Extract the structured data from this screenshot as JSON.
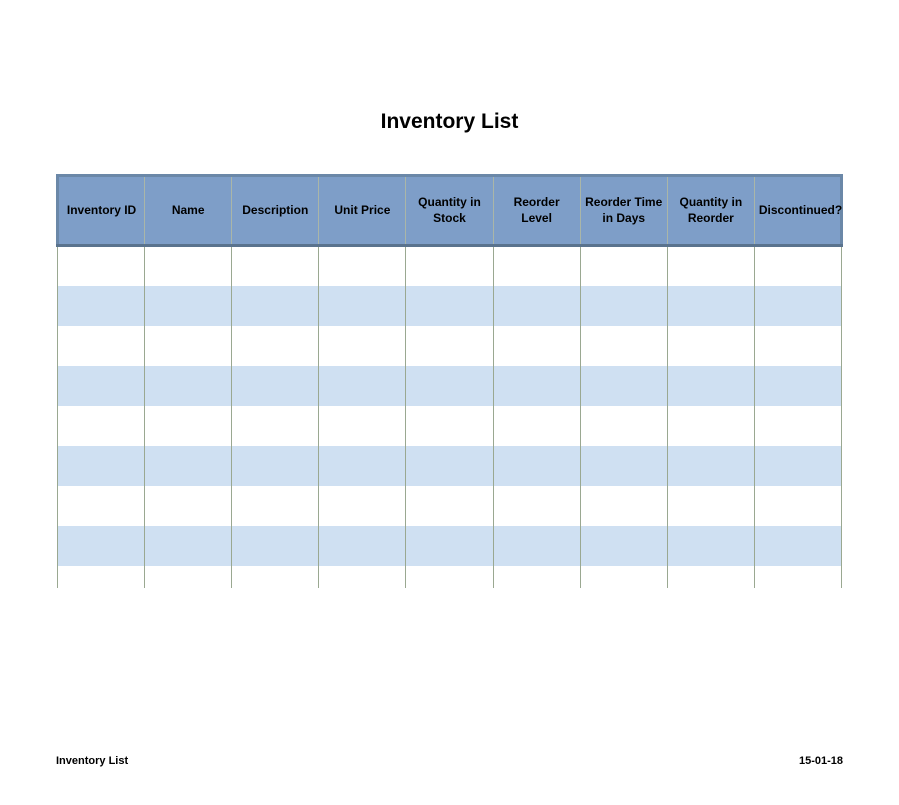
{
  "title": "Inventory List",
  "columns": [
    "Inventory ID",
    "Name",
    "Description",
    "Unit Price",
    "Quantity in Stock",
    "Reorder Level",
    "Reorder Time in Days",
    "Quantity in Reorder",
    "Discontinued?"
  ],
  "footer": {
    "left": "Inventory List",
    "right": "15-01-18"
  }
}
